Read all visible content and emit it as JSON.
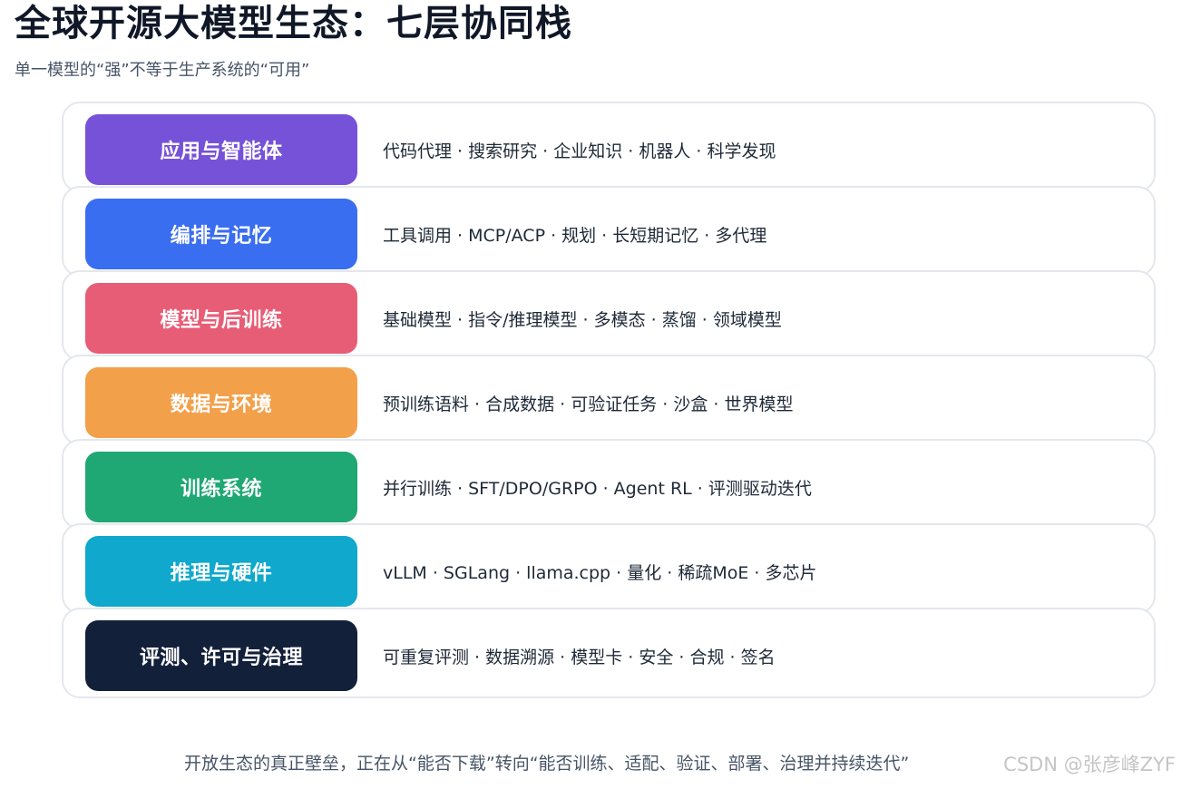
{
  "title": "全球开源大模型生态：七层协同栈",
  "subtitle": "单一模型的“强”不等于生产系统的“可用”",
  "layers": [
    {
      "label": "应用与智能体",
      "color": "#7652d8",
      "description": "代码代理 · 搜索研究 · 企业知识 · 机器人 · 科学发现"
    },
    {
      "label": "编排与记忆",
      "color": "#3a6ef0",
      "description": "工具调用 · MCP/ACP · 规划 · 长短期记忆 · 多代理"
    },
    {
      "label": "模型与后训练",
      "color": "#e85d76",
      "description": "基础模型 · 指令/推理模型 · 多模态 · 蒸馏 · 领域模型"
    },
    {
      "label": "数据与环境",
      "color": "#f3a04b",
      "description": "预训练语料 · 合成数据 · 可验证任务 · 沙盒 · 世界模型"
    },
    {
      "label": "训练系统",
      "color": "#1fa874",
      "description": "并行训练 · SFT/DPO/GRPO · Agent RL · 评测驱动迭代"
    },
    {
      "label": "推理与硬件",
      "color": "#10a8cc",
      "description": "vLLM · SGLang · llama.cpp · 量化 · 稀疏MoE · 多芯片"
    },
    {
      "label": "评测、许可与治理",
      "color": "#13203a",
      "description": "可重复评测 · 数据溯源 · 模型卡 · 安全 · 合规 · 签名"
    }
  ],
  "footer": "开放生态的真正壁垒，正在从“能否下载”转向“能否训练、适配、验证、部署、治理并持续迭代”",
  "watermark": "CSDN @张彦峰ZYF"
}
